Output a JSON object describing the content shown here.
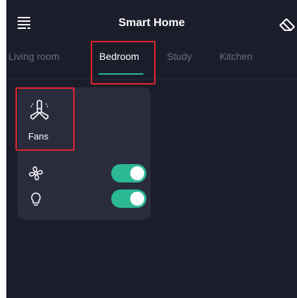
{
  "header": {
    "title": "Smart Home",
    "menu_icon": "menu-icon",
    "action_icon": "eraser-icon"
  },
  "tabs": [
    {
      "label": "Living room",
      "active": false
    },
    {
      "label": "Bedroom",
      "active": true
    },
    {
      "label": "Study",
      "active": false
    },
    {
      "label": "Kitchen",
      "active": false
    }
  ],
  "device_card": {
    "tile": {
      "label": "Fans",
      "icon": "ceiling-fan-icon"
    },
    "controls": [
      {
        "icon": "fan-icon",
        "on": true
      },
      {
        "icon": "lightbulb-icon",
        "on": true
      }
    ]
  },
  "colors": {
    "background": "#1c1d2b",
    "card": "#2a2c3e",
    "accent": "#2bb893",
    "highlight": "#e0262c",
    "inactive_text": "#6b6e7e"
  }
}
